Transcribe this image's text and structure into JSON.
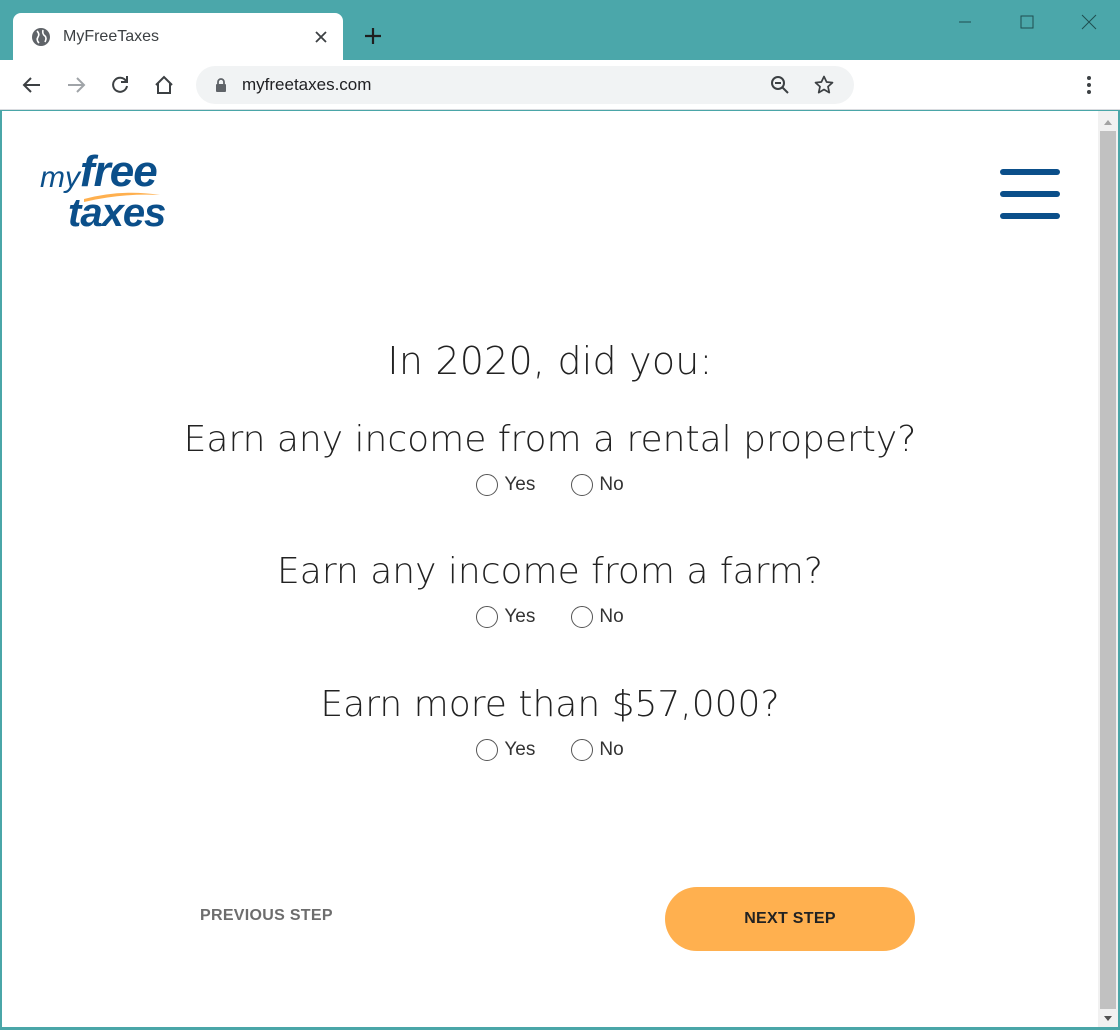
{
  "browser": {
    "tab_title": "MyFreeTaxes",
    "url": "myfreetaxes.com",
    "icons": {
      "favicon": "globe-icon",
      "tab_close": "close-icon",
      "new_tab": "plus-icon",
      "minimize": "minimize-icon",
      "maximize": "maximize-icon",
      "close_window": "close-icon",
      "back": "arrow-left-icon",
      "forward": "arrow-right-icon",
      "reload": "reload-icon",
      "home": "home-icon",
      "lock": "lock-icon",
      "zoom": "zoom-out-icon",
      "bookmark": "star-icon",
      "menu": "kebab-menu-icon"
    },
    "colors": {
      "frame": "#4ba7aa"
    }
  },
  "page": {
    "logo": {
      "my": "my",
      "free": "free",
      "taxes": "taxes"
    },
    "menu_icon": "hamburger-icon",
    "heading": "In 2020, did you:",
    "questions": [
      {
        "text": "Earn any income from a rental property?",
        "options": [
          "Yes",
          "No"
        ]
      },
      {
        "text": "Earn any income from a farm?",
        "options": [
          "Yes",
          "No"
        ]
      },
      {
        "text": "Earn more than $57,000?",
        "options": [
          "Yes",
          "No"
        ]
      }
    ],
    "previous_label": "PREVIOUS STEP",
    "next_label": "NEXT STEP",
    "colors": {
      "brand_blue": "#0b4f8a",
      "accent_orange": "#ffb04f"
    }
  }
}
